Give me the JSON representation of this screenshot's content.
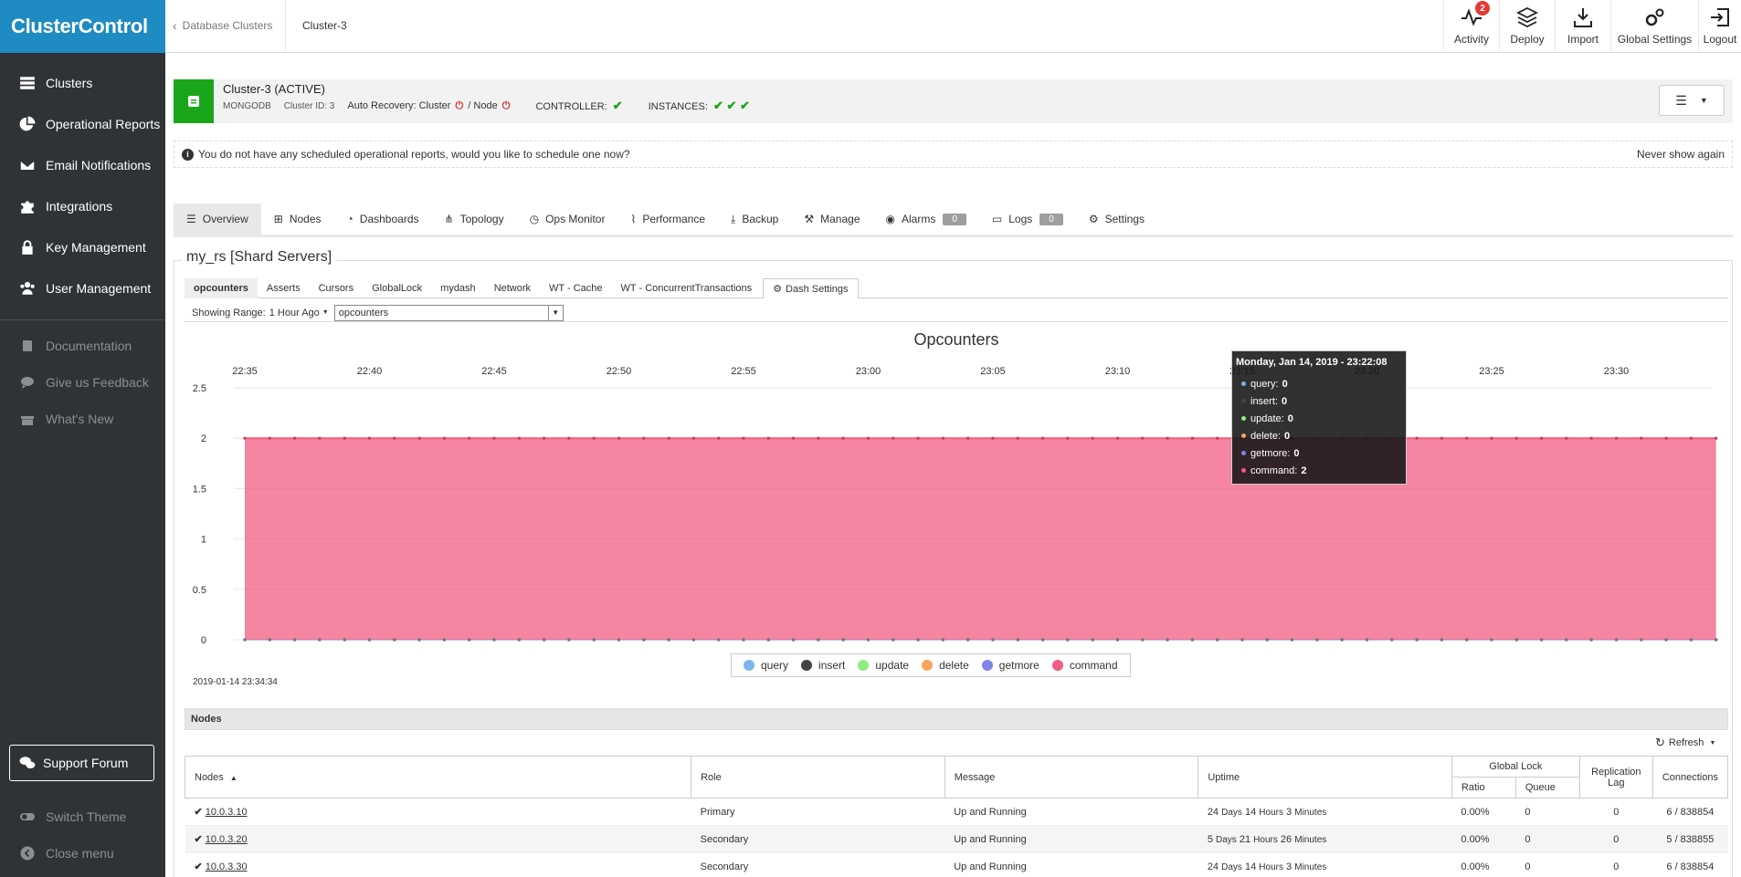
{
  "app": {
    "logo": "ClusterControl"
  },
  "sidebar": {
    "items": [
      {
        "label": "Clusters",
        "icon": "clusters-icon"
      },
      {
        "label": "Operational Reports",
        "icon": "pie-chart-icon"
      },
      {
        "label": "Email Notifications",
        "icon": "envelope-icon"
      },
      {
        "label": "Integrations",
        "icon": "puzzle-icon"
      },
      {
        "label": "Key Management",
        "icon": "lock-icon"
      },
      {
        "label": "User Management",
        "icon": "users-icon"
      }
    ],
    "secondary": [
      {
        "label": "Documentation",
        "icon": "book-icon"
      },
      {
        "label": "Give us Feedback",
        "icon": "comment-icon"
      },
      {
        "label": "What's New",
        "icon": "gift-icon"
      }
    ],
    "support_label": "Support Forum",
    "switch_theme": "Switch Theme",
    "close_menu": "Close menu"
  },
  "topbar": {
    "back_label": "Database Clusters",
    "current": "Cluster-3",
    "activity": "Activity",
    "activity_badge": "2",
    "deploy": "Deploy",
    "import": "Import",
    "global_settings": "Global Settings",
    "logout": "Logout"
  },
  "cluster": {
    "name": "Cluster-3 (ACTIVE)",
    "type": "MONGODB",
    "id": "Cluster ID: 3",
    "auto_recovery": "Auto Recovery: Cluster",
    "node_label": "/ Node",
    "controller": "CONTROLLER:",
    "instances": "INSTANCES:"
  },
  "notice": {
    "text": "You do not have any scheduled operational reports, would you like to schedule one now?",
    "dismiss": "Never show again"
  },
  "tabs": [
    {
      "label": "Overview",
      "icon": "list-icon",
      "active": true
    },
    {
      "label": "Nodes",
      "icon": "sitemap-icon"
    },
    {
      "label": "Dashboards",
      "icon": "dashboard-icon"
    },
    {
      "label": "Topology",
      "icon": "topology-icon"
    },
    {
      "label": "Ops Monitor",
      "icon": "clock-icon"
    },
    {
      "label": "Performance",
      "icon": "line-chart-icon"
    },
    {
      "label": "Backup",
      "icon": "download-icon"
    },
    {
      "label": "Manage",
      "icon": "wrench-icon"
    },
    {
      "label": "Alarms",
      "icon": "broadcast-icon",
      "count": "0"
    },
    {
      "label": "Logs",
      "icon": "drive-icon",
      "count": "0"
    },
    {
      "label": "Settings",
      "icon": "gear-icon"
    }
  ],
  "panel": {
    "legend": "my_rs [Shard Servers]",
    "dash_tabs": [
      "opcounters",
      "Asserts",
      "Cursors",
      "GlobalLock",
      "mydash",
      "Network",
      "WT - Cache",
      "WT - ConcurrentTransactions"
    ],
    "dash_settings": "Dash Settings",
    "range_label": "Showing Range:",
    "range_value": "1 Hour Ago",
    "metric_select": "opcounters",
    "chart_date": "2019-01-14 23:34:34"
  },
  "chart_data": {
    "type": "area",
    "title": "Opcounters",
    "x_ticks": [
      "22:35",
      "22:40",
      "22:45",
      "22:50",
      "22:55",
      "23:00",
      "23:05",
      "23:10",
      "23:15",
      "23:20",
      "23:25",
      "23:30"
    ],
    "x_range": [
      "22:35",
      "23:34"
    ],
    "ylim": [
      0,
      2.5
    ],
    "y_ticks": [
      0,
      0.5,
      1,
      1.5,
      2,
      2.5
    ],
    "grid": true,
    "legend_position": "bottom",
    "series": [
      {
        "name": "query",
        "color": "#7cb5ec",
        "value": 0
      },
      {
        "name": "insert",
        "color": "#434348",
        "value": 0
      },
      {
        "name": "update",
        "color": "#90ed7d",
        "value": 0
      },
      {
        "name": "delete",
        "color": "#f7a35c",
        "value": 0
      },
      {
        "name": "getmore",
        "color": "#8085e9",
        "value": 0
      },
      {
        "name": "command",
        "color": "#f15c80",
        "value": 2
      }
    ],
    "tooltip": {
      "title": "Monday, Jan 14, 2019 - 23:22:08",
      "rows": [
        {
          "name": "query:",
          "value": "0",
          "color": "#7cb5ec"
        },
        {
          "name": "insert:",
          "value": "0",
          "color": "#434348"
        },
        {
          "name": "update:",
          "value": "0",
          "color": "#90ed7d"
        },
        {
          "name": "delete:",
          "value": "0",
          "color": "#f7a35c"
        },
        {
          "name": "getmore:",
          "value": "0",
          "color": "#8085e9"
        },
        {
          "name": "command:",
          "value": "2",
          "color": "#f15c80"
        }
      ]
    }
  },
  "nodes": {
    "title": "Nodes",
    "refresh": "Refresh",
    "headers": {
      "nodes": "Nodes",
      "role": "Role",
      "message": "Message",
      "uptime": "Uptime",
      "global_lock": "Global Lock",
      "ratio": "Ratio",
      "queue": "Queue",
      "replication_lag": "Replication Lag",
      "connections": "Connections"
    },
    "rows": [
      {
        "host": "10.0.3.10",
        "role": "Primary",
        "message": "Up and Running",
        "uptime_days": "24",
        "uptime_hours": "14",
        "uptime_minutes": "3",
        "ratio": "0.00%",
        "queue": "0",
        "lag": "0",
        "connections": "6 / 838854"
      },
      {
        "host": "10.0.3.20",
        "role": "Secondary",
        "message": "Up and Running",
        "uptime_days": "5",
        "uptime_hours": "21",
        "uptime_minutes": "26",
        "ratio": "0.00%",
        "queue": "0",
        "lag": "0",
        "connections": "5 / 838855"
      },
      {
        "host": "10.0.3.30",
        "role": "Secondary",
        "message": "Up and Running",
        "uptime_days": "24",
        "uptime_hours": "14",
        "uptime_minutes": "3",
        "ratio": "0.00%",
        "queue": "0",
        "lag": "0",
        "connections": "6 / 838854"
      }
    ]
  }
}
